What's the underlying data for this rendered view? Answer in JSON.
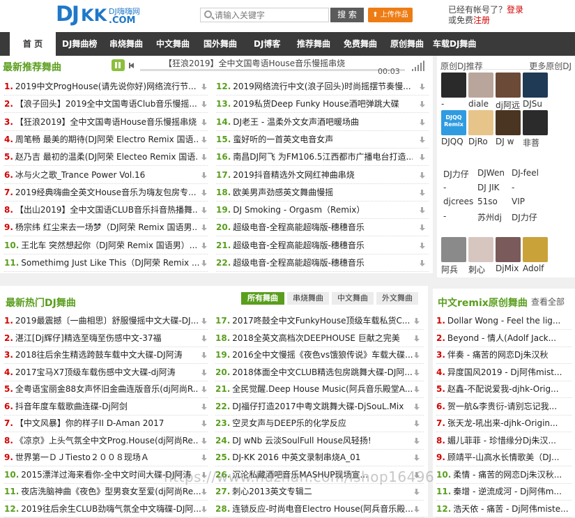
{
  "header": {
    "logo_main": "DJ",
    "logo_kk": "KK",
    "logo_dot": ".COM",
    "logo_sub": "DJ嗨嗨网",
    "search_placeholder": "请输入关键字",
    "search_button": "搜 索",
    "upload_button": "上传作品",
    "login_prefix": "已经有帐号了？",
    "login_link": "登录",
    "register_prefix": "或免费",
    "register_link": "注册"
  },
  "nav": [
    "首 页",
    "DJ舞曲榜",
    "串烧舞曲",
    "中文舞曲",
    "国外舞曲",
    "DJ博客",
    "推荐舞曲",
    "免费舞曲",
    "原创舞曲",
    "车载DJ舞曲"
  ],
  "recommend": {
    "title": "最新推荐舞曲",
    "player_title": "【狂浪2019】全中文国粤语House音乐慢摇串烧",
    "player_time": "00:03",
    "left": [
      {
        "n": "1.",
        "t": "2019中文ProgHouse(请先说你好)网络流行节..."
      },
      {
        "n": "2.",
        "t": "【浪子回头】2019全中文国粤语Club音乐慢摇..."
      },
      {
        "n": "3.",
        "t": "【狂浪2019】全中文国粤语House音乐慢摇串烧"
      },
      {
        "n": "4.",
        "t": "周笔畅 最美的期待(DJ阿荣 Electro Remix 国语..."
      },
      {
        "n": "5.",
        "t": "赵乃吉 最初的温柔(DJ阿荣 Electeo Remix 国语..."
      },
      {
        "n": "6.",
        "t": "冰与火之歌_Trance Power Vol.16"
      },
      {
        "n": "7.",
        "t": "2019经典嗨曲全英文House音乐为嗨友包房专..."
      },
      {
        "n": "8.",
        "t": "【出山2019】全中文国语CLUB音乐抖音热播舞..."
      },
      {
        "n": "9.",
        "t": "杨宗纬 红尘来去一场梦（DJ阿荣 Remix 国语男..."
      },
      {
        "n": "10.",
        "t": "王北车 突然想起你（DJ阿荣 Remix 国语男）..."
      },
      {
        "n": "11.",
        "t": "Somethimg Just Like This（DJ阿荣 Remix ..."
      }
    ],
    "right": [
      {
        "n": "12.",
        "t": "2019网络流行中文(浪子回头)时尚摇摆节奏慢..."
      },
      {
        "n": "13.",
        "t": "2019私货Deep Funky House酒吧弹跳大碟"
      },
      {
        "n": "14.",
        "t": "DJ老王 - 温柔外文女声酒吧暖场曲"
      },
      {
        "n": "15.",
        "t": "蛮好听的一首英文电音女声"
      },
      {
        "n": "16.",
        "t": "南昌DJ阿飞 为FM106.5江西都市广播电台打造..."
      },
      {
        "n": "17.",
        "t": "2019抖音精选外文网红神曲串烧"
      },
      {
        "n": "18.",
        "t": "欧美男声劲感英文舞曲慢摇"
      },
      {
        "n": "19.",
        "t": "DJ Smoking - Orgasm（Remix）"
      },
      {
        "n": "20.",
        "t": "超级电音-全程高能超嗨版-穗穗音乐"
      },
      {
        "n": "21.",
        "t": "超级电音-全程高能超嗨版-穗穗音乐"
      },
      {
        "n": "22.",
        "t": "超级电音-全程高能超嗨版-穗穗音乐"
      }
    ]
  },
  "original_dj": {
    "title": "原创DJ推荐",
    "more": "更多原创DJ",
    "row1": [
      {
        "name": "-",
        "color": "#2a2a2a"
      },
      {
        "name": "diale",
        "color": "#b9a59b"
      },
      {
        "name": "dj阿远",
        "color": "#6b4a38"
      },
      {
        "name": "DJSu",
        "color": "#1e3a55"
      }
    ],
    "row2": [
      {
        "name": "DJQQ",
        "color": "#2f9be0",
        "badge": "DJQQ Remix"
      },
      {
        "name": "DjRo",
        "color": "#e7c48a"
      },
      {
        "name": "DJ w",
        "color": "#4a3522"
      },
      {
        "name": "非菩",
        "color": "#2b2b2b"
      }
    ],
    "names": [
      [
        "DJ力仔",
        "DJWen",
        "DJ-feel"
      ],
      [
        "-",
        "DJ JIK",
        "-"
      ],
      [
        "djcrees",
        "51so",
        "VIP"
      ],
      [
        "-",
        "苏州dj",
        "DJ力仔"
      ]
    ],
    "row3": [
      {
        "name": "阿兵",
        "color": "#8a8a8a"
      },
      {
        "name": "刺心",
        "color": "#d7c6c0"
      },
      {
        "name": "DjMix",
        "color": "#7a5a5a"
      },
      {
        "name": "Adolf",
        "color": "#c9a23a"
      }
    ]
  },
  "hot": {
    "title": "最新热门DJ舞曲",
    "tabs": [
      "所有舞曲",
      "串烧舞曲",
      "中文舞曲",
      "外文舞曲"
    ],
    "left": [
      {
        "n": "1.",
        "t": "2019最震撼〔一曲相思〕舒服慢摇中文大碟-DJ..."
      },
      {
        "n": "2.",
        "t": "湛江[Dj辉仔]精选至嗨至伤感中文-37福"
      },
      {
        "n": "3.",
        "t": "2018往后余生精选跨鼓车载中文大碟-DJ阿涛"
      },
      {
        "n": "4.",
        "t": "2017宝马X7顶级车载伤感中文大碟-dj阿涛"
      },
      {
        "n": "5.",
        "t": "全粤语宝丽金88女声怀旧金曲连版音乐(dj阿尚R..."
      },
      {
        "n": "6.",
        "t": "抖音年度车载歌曲连碟-Dj阿剑"
      },
      {
        "n": "7.",
        "t": "【中文风暴】你的样子II D-Aman 2017"
      },
      {
        "n": "8.",
        "t": "《凉京》上头气氛全中文Prog.House(dj阿尚Re..."
      },
      {
        "n": "9.",
        "t": "世界第一ＤＪTiesto２００８现场Ａ"
      },
      {
        "n": "10.",
        "t": "2015漂洋过海来看你-全中文时间大碟-DJ阿涛"
      },
      {
        "n": "11.",
        "t": "夜店洗脑神曲《夜色》型男衰女至爱(dj阿尚Re..."
      },
      {
        "n": "12.",
        "t": "2019往后余生CLUB劲嗨气氛全中文嗨碟-DJ阿..."
      }
    ],
    "right": [
      {
        "n": "17.",
        "t": "2017咚鼓全中文FunkyHouse顶级车载私货C..."
      },
      {
        "n": "18.",
        "t": "2018全英文高档次DEEPHOUSE 巨献之完美"
      },
      {
        "n": "19.",
        "t": "2016全中文慢摇《夜色vs饿狼传说》车载大碟..."
      },
      {
        "n": "20.",
        "t": "2018体面全中文CLUB精选包房跳舞大碟-DJ阿..."
      },
      {
        "n": "21.",
        "t": "全民觉醒.Deep House Music(阿兵音乐殿堂A..."
      },
      {
        "n": "22.",
        "t": "DJ福仔打造2017中粤文跳舞大碟-DjSouL.Mix"
      },
      {
        "n": "23.",
        "t": "空灵女声与DEEP乐的化学反应"
      },
      {
        "n": "24.",
        "t": "DJ wNb 云淡SoulFull House风轻扬!"
      },
      {
        "n": "25.",
        "t": "DJ-KK 2016 中英文录制串烧A_01"
      },
      {
        "n": "26.",
        "t": "沉沦私藏酒吧音乐MASHUP现场宣..."
      },
      {
        "n": "27.",
        "t": "刺心2013英文专辑二"
      },
      {
        "n": "28.",
        "t": "连锁反应-时尚电音Electro House(阿兵音乐殿..."
      }
    ]
  },
  "remix": {
    "title": "中文remix原创舞曲",
    "more": "查看全部",
    "items": [
      {
        "n": "1.",
        "t": "Dollar Wong - Feel the lig..."
      },
      {
        "n": "2.",
        "t": "Beyond - 情人(Adolf Jack..."
      },
      {
        "n": "3.",
        "t": "伴奏 - 痛苦的网恋Dj朱汉秋"
      },
      {
        "n": "4.",
        "t": "异度国风2019 - Dj阿伟mist..."
      },
      {
        "n": "5.",
        "t": "赵鑫-不配说爱我-djhk-Orig..."
      },
      {
        "n": "6.",
        "t": "贺一航&李贵衍-请别忘记我..."
      },
      {
        "n": "7.",
        "t": "张天龙-吼出来-djhk-Origin..."
      },
      {
        "n": "8.",
        "t": "媚儿菲菲 - 珍惜缘分Dj朱汉..."
      },
      {
        "n": "9.",
        "t": "顾靖平-山高水长情歌美（DJ..."
      },
      {
        "n": "10.",
        "t": "柔情 - 痛苦的网恋Dj朱汉秋..."
      },
      {
        "n": "11.",
        "t": "秦增 - 逆流成河 - Dj阿伟m..."
      },
      {
        "n": "12.",
        "t": "浩天依 - 痛苦 - Dj阿伟miste..."
      }
    ]
  },
  "watermark": "https://www.huzhan.com/ishop16496"
}
